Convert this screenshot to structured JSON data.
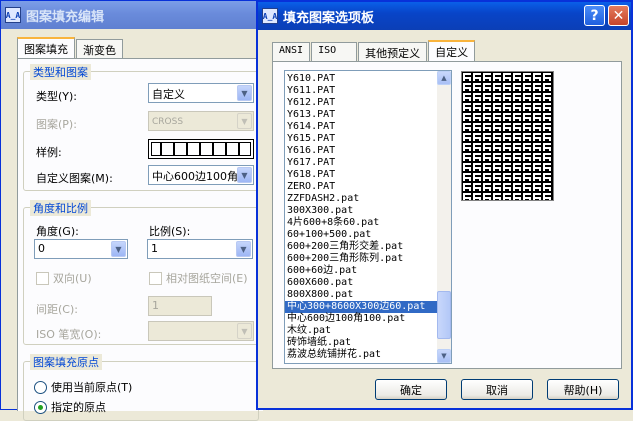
{
  "back_dialog": {
    "title": "图案填充编辑",
    "icon_text": "A̲A",
    "tabs": [
      "图案填充",
      "渐变色"
    ],
    "type_pattern_group": {
      "label": "类型和图案",
      "type_label": "类型(Y):",
      "type_value": "自定义",
      "pattern_label": "图案(P):",
      "pattern_value": "CROSS",
      "swatch_label": "样例:",
      "custom_label": "自定义图案(M):",
      "custom_value": "中心600边100角"
    },
    "angle_scale_group": {
      "label": "角度和比例",
      "angle_label": "角度(G):",
      "angle_value": "0",
      "scale_label": "比例(S):",
      "scale_value": "1",
      "double_label": "双向(U)",
      "relative_label": "相对图纸空间(E)",
      "spacing_label": "间距(C):",
      "spacing_value": "1",
      "iso_label": "ISO 笔宽(O):"
    },
    "origin_group": {
      "label": "图案填充原点",
      "use_current": "使用当前原点(T)",
      "specified": "指定的原点"
    }
  },
  "front_dialog": {
    "title": "填充图案选项板",
    "icon_text": "A̲A",
    "help_glyph": "?",
    "close_glyph": "✕",
    "tabs": [
      "ANSI",
      "ISO",
      "其他预定义",
      "自定义"
    ],
    "list_items": [
      "Y610.PAT",
      "Y611.PAT",
      "Y612.PAT",
      "Y613.PAT",
      "Y614.PAT",
      "Y615.PAT",
      "Y616.PAT",
      "Y617.PAT",
      "Y618.PAT",
      "ZERO.PAT",
      "ZZFDASH2.pat",
      "300X300.pat",
      "4片600+8条60.pat",
      "60+100+500.pat",
      "600+200三角形交差.pat",
      "600+200三角形陈列.pat",
      "600+60边.pat",
      "600X600.pat",
      "800X800.pat",
      "中心300+8600X300边60.pat",
      "中心600边100角100.pat",
      "木纹.pat",
      "砖饰墙纸.pat",
      "荔波总统铺拼花.pat"
    ],
    "selected_index": 19,
    "buttons": {
      "ok": "确定",
      "cancel": "取消",
      "help": "帮助(H)"
    }
  }
}
